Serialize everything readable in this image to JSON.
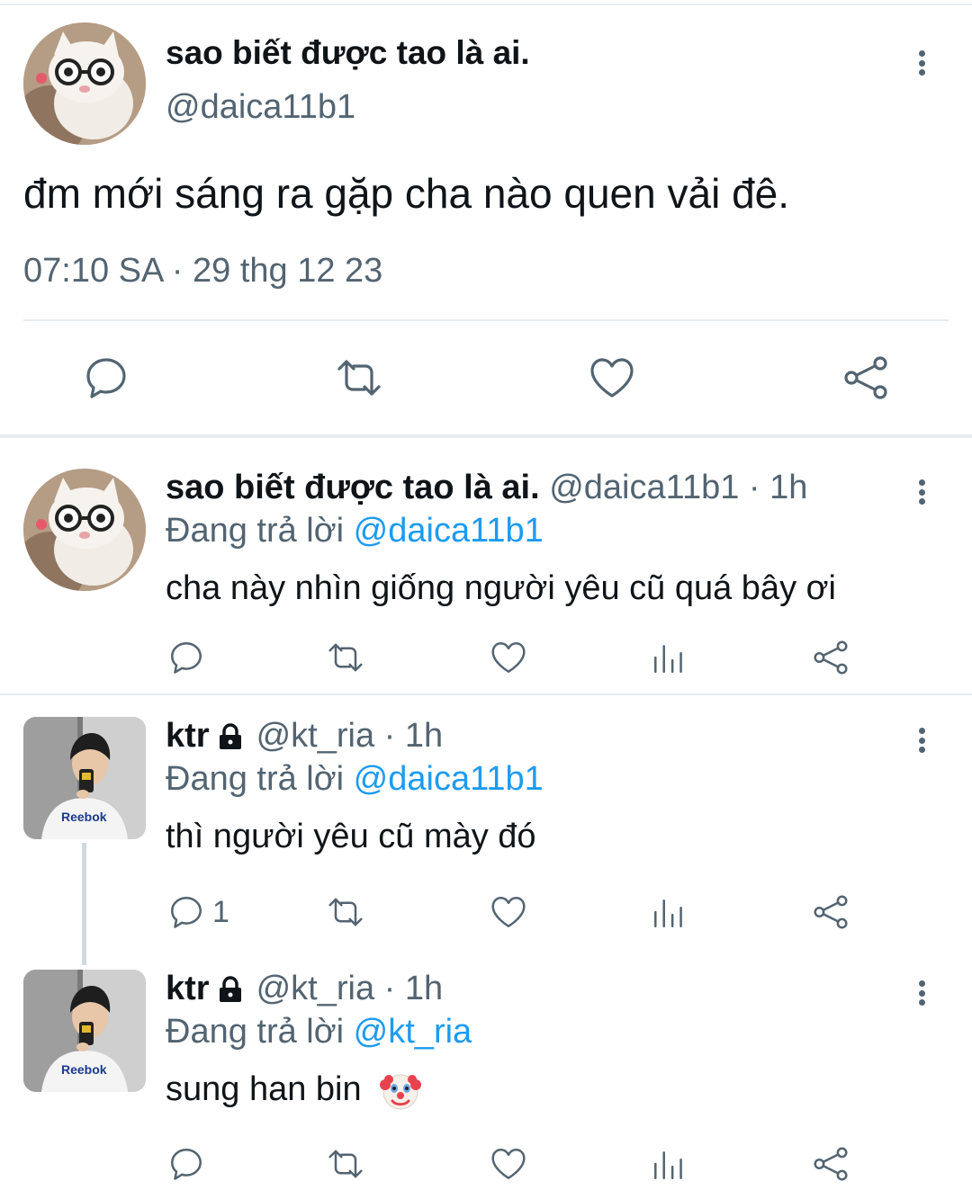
{
  "main_tweet": {
    "display_name": "sao biết được tao là ai.",
    "handle": "@daica11b1",
    "text": "đm mới sáng ra gặp cha nào quen vải đê.",
    "timestamp": "07:10 SA · 29 thg 12 23"
  },
  "replies": [
    {
      "display_name": "sao biết được tao là ai.",
      "meta": "@daica11b1 · 1h",
      "replying_prefix": "Đang trả lời",
      "replying_to": "@daica11b1",
      "text": "cha này nhìn giống người yêu cũ quá bây ơi",
      "reply_count": ""
    },
    {
      "display_name": "ktr",
      "meta": "@kt_ria · 1h",
      "replying_prefix": "Đang trả lời",
      "replying_to": "@daica11b1",
      "text": "thì người yêu cũ mày đó",
      "reply_count": "1"
    },
    {
      "display_name": "ktr",
      "meta": "@kt_ria · 1h",
      "replying_prefix": "Đang trả lời",
      "replying_to": "@kt_ria",
      "text": "sung han bin",
      "reply_count": ""
    }
  ],
  "icons": [
    "reply-icon",
    "retweet-icon",
    "like-icon",
    "share-icon",
    "views-icon",
    "more-icon",
    "lock-icon",
    "clown-emoji"
  ],
  "colors": {
    "text": "#0f1419",
    "secondary": "#536471",
    "link": "#1d9bf0",
    "divider": "#e6ecf0"
  }
}
